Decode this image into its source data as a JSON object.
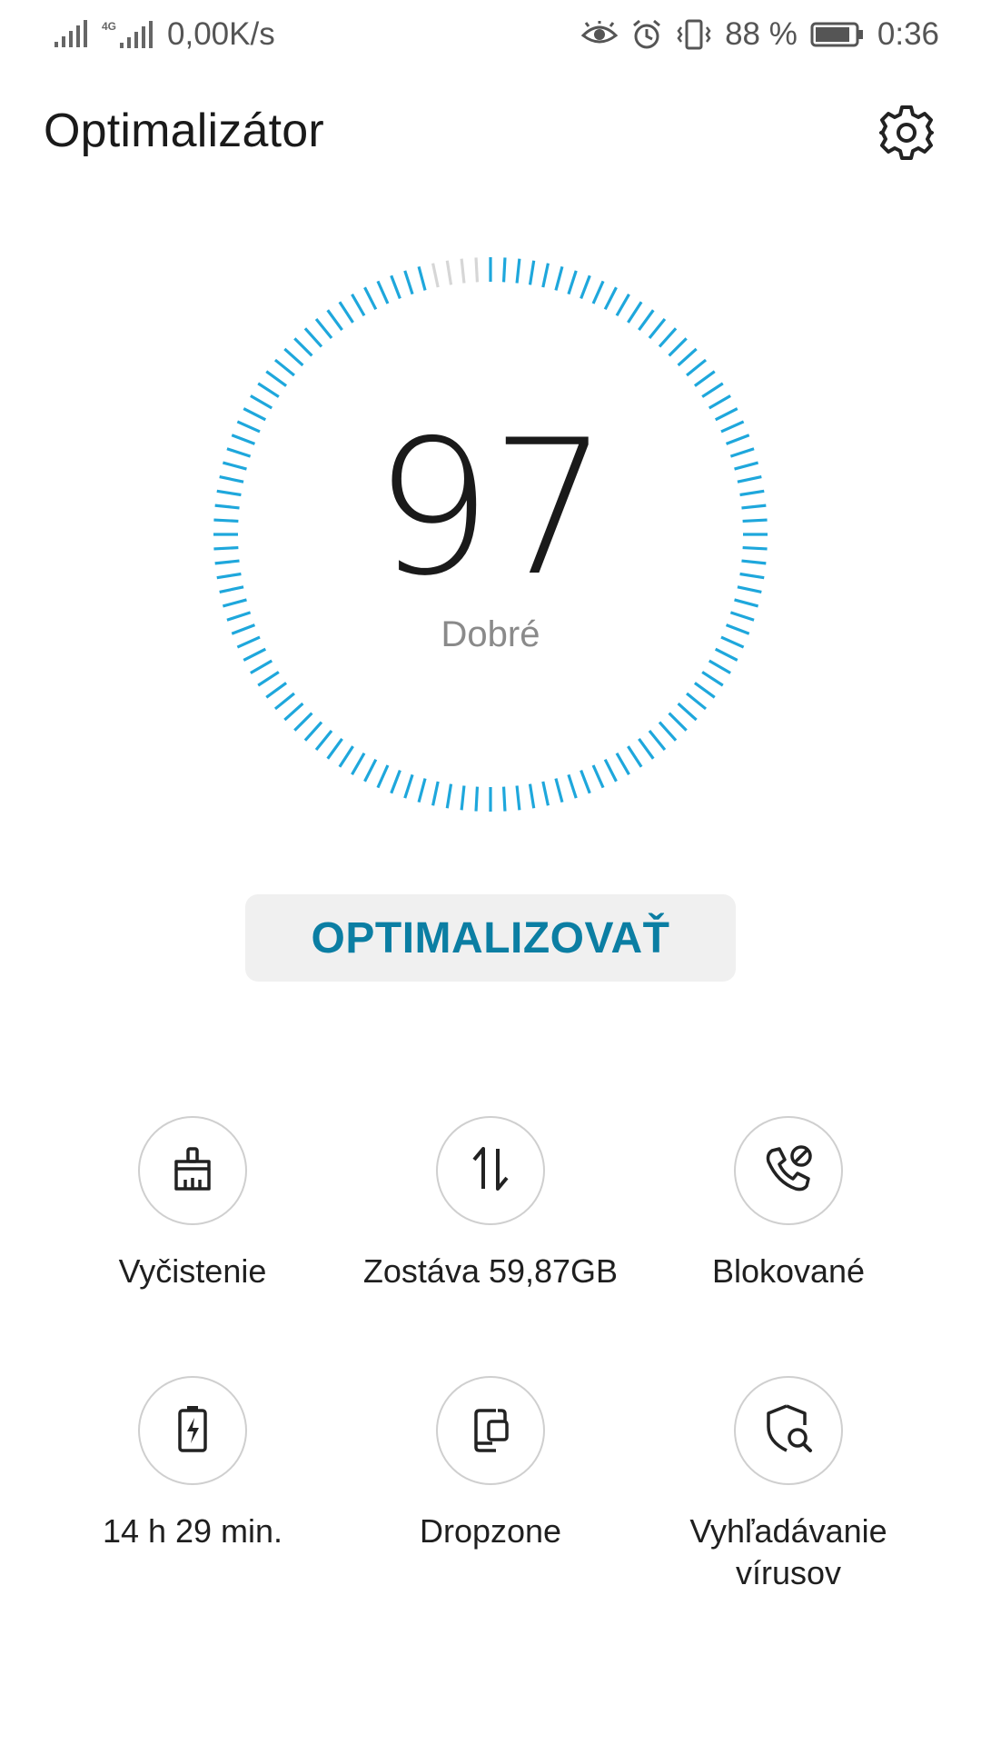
{
  "status_bar": {
    "network_speed": "0,00K/s",
    "network_type": "4G",
    "battery_percent": "88 %",
    "battery_level": 0.88,
    "time": "0:36"
  },
  "header": {
    "title": "Optimalizátor"
  },
  "score": {
    "value": "97",
    "label": "Dobré",
    "fill_fraction": 0.97,
    "accent_color": "#1ea7dc",
    "track_color": "#d6d6d6"
  },
  "optimize_button": {
    "label": "OPTIMALIZOVAŤ"
  },
  "tools": [
    {
      "icon": "broom-icon",
      "label": "Vyčistenie"
    },
    {
      "icon": "data-transfer-icon",
      "label": "Zostáva 59,87GB"
    },
    {
      "icon": "blocked-call-icon",
      "label": "Blokované"
    },
    {
      "icon": "battery-charge-icon",
      "label": "14 h 29 min."
    },
    {
      "icon": "dropzone-icon",
      "label": "Dropzone"
    },
    {
      "icon": "virus-scan-icon",
      "label": "Vyhľadávanie vírusov"
    }
  ]
}
